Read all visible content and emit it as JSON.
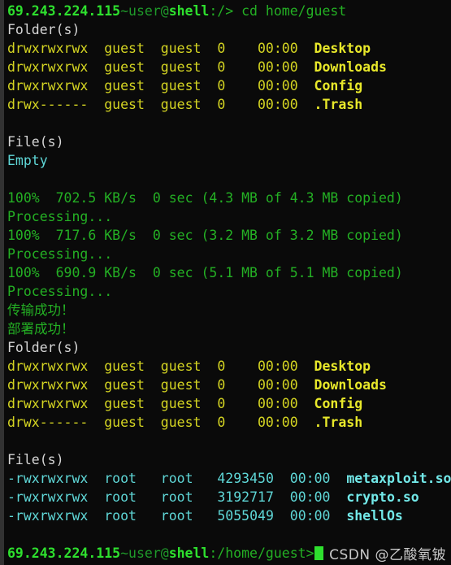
{
  "terminal": {
    "background": "#0a0a0a",
    "colors": {
      "green": "#24b024",
      "bright_green": "#2ee02e",
      "yellow": "#d4d422",
      "cyan": "#5fd7d7",
      "white": "#d6d6d6",
      "cursor": "#2ee02e",
      "watermark": "#c8c8c8"
    },
    "prompt_top": {
      "host": "69.243.224.115",
      "user": "~user@",
      "shell": "shell",
      "path": ":/>",
      "command": " cd home/guest"
    },
    "prompt_bottom": {
      "host": "69.243.224.115",
      "user": "~user@",
      "shell": "shell",
      "path": ":/home/guest>",
      "command": ""
    },
    "section_folders_label": "Folder(s)",
    "section_files_label": "File(s)",
    "empty_label": "Empty",
    "folders": [
      {
        "perms": "drwxrwxrwx",
        "owner": "guest",
        "group": "guest",
        "size": "0",
        "time": "00:00",
        "name": "Desktop"
      },
      {
        "perms": "drwxrwxrwx",
        "owner": "guest",
        "group": "guest",
        "size": "0",
        "time": "00:00",
        "name": "Downloads"
      },
      {
        "perms": "drwxrwxrwx",
        "owner": "guest",
        "group": "guest",
        "size": "0",
        "time": "00:00",
        "name": "Config"
      },
      {
        "perms": "drwx------",
        "owner": "guest",
        "group": "guest",
        "size": "0",
        "time": "00:00",
        "name": ".Trash"
      }
    ],
    "files": [
      {
        "perms": "-rwxrwxrwx",
        "owner": "root",
        "group": "root",
        "size": "4293450",
        "time": "00:00",
        "name": "metaxploit.so"
      },
      {
        "perms": "-rwxrwxrwx",
        "owner": "root",
        "group": "root",
        "size": "3192717",
        "time": "00:00",
        "name": "crypto.so"
      },
      {
        "perms": "-rwxrwxrwx",
        "owner": "root",
        "group": "root",
        "size": "5055049",
        "time": "00:00",
        "name": "shellOs"
      }
    ],
    "transfers": [
      {
        "progress": "100%",
        "speed": "702.5 KB/s",
        "eta": "0 sec",
        "detail": "(4.3 MB of 4.3 MB copied)",
        "status": "Processing..."
      },
      {
        "progress": "100%",
        "speed": "717.6 KB/s",
        "eta": "0 sec",
        "detail": "(3.2 MB of 3.2 MB copied)",
        "status": "Processing..."
      },
      {
        "progress": "100%",
        "speed": "690.9 KB/s",
        "eta": "0 sec",
        "detail": "(5.1 MB of 5.1 MB copied)",
        "status": "Processing..."
      }
    ],
    "messages": [
      "传输成功！",
      "部署成功！"
    ],
    "watermark": "CSDN @乙酸氧铍"
  }
}
